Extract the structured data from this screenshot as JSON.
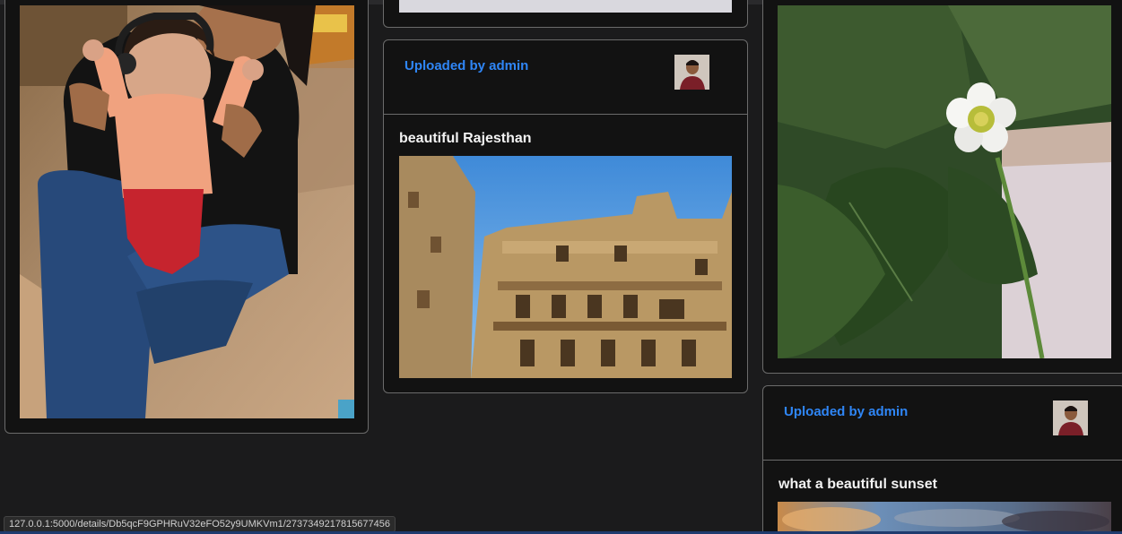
{
  "posts": [
    {
      "uploader": "Uploaded by admin",
      "title": "beautiful Rajesthan"
    },
    {
      "uploader": "Uploaded by admin",
      "title": "what a beautiful sunset"
    }
  ],
  "status_bar": {
    "url": "127.0.0.1:5000/details/Db5qcF9GPHRuV32eFO52y9UMKVm1/2737349217815677456"
  }
}
